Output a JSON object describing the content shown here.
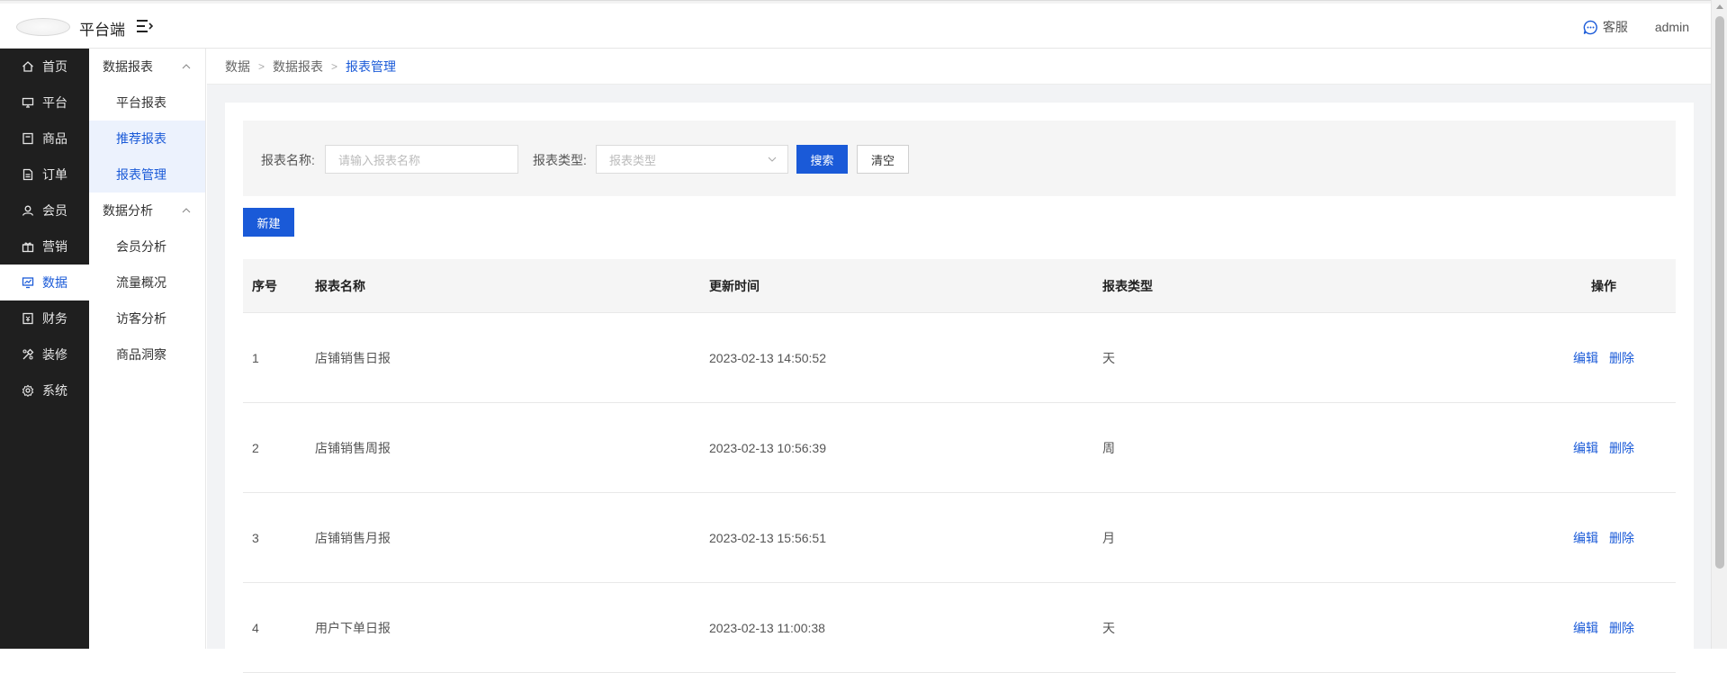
{
  "header": {
    "brand": "平台端",
    "kefu_label": "客服",
    "user": "admin"
  },
  "sidebar": {
    "items": [
      {
        "label": "首页",
        "icon": "home-icon",
        "active": false
      },
      {
        "label": "平台",
        "icon": "monitor-icon",
        "active": false
      },
      {
        "label": "商品",
        "icon": "goods-icon",
        "active": false
      },
      {
        "label": "订单",
        "icon": "order-icon",
        "active": false
      },
      {
        "label": "会员",
        "icon": "member-icon",
        "active": false
      },
      {
        "label": "营销",
        "icon": "gift-icon",
        "active": false
      },
      {
        "label": "数据",
        "icon": "chart-icon",
        "active": true
      },
      {
        "label": "财务",
        "icon": "finance-icon",
        "active": false
      },
      {
        "label": "装修",
        "icon": "decorate-icon",
        "active": false
      },
      {
        "label": "系统",
        "icon": "settings-icon",
        "active": false
      }
    ]
  },
  "subnav": {
    "group1": "数据报表",
    "group1_items": [
      "平台报表",
      "推荐报表",
      "报表管理"
    ],
    "group2": "数据分析",
    "group2_items": [
      "会员分析",
      "流量概况",
      "访客分析",
      "商品洞察"
    ]
  },
  "breadcrumb": [
    "数据",
    "数据报表",
    "报表管理"
  ],
  "filter": {
    "name_label": "报表名称:",
    "name_placeholder": "请输入报表名称",
    "type_label": "报表类型:",
    "type_placeholder": "报表类型",
    "search_btn": "搜索",
    "clear_btn": "清空"
  },
  "new_btn": "新建",
  "table": {
    "headers": [
      "序号",
      "报表名称",
      "更新时间",
      "报表类型",
      "操作"
    ],
    "rows": [
      {
        "idx": "1",
        "name": "店铺销售日报",
        "time": "2023-02-13 14:50:52",
        "type": "天"
      },
      {
        "idx": "2",
        "name": "店铺销售周报",
        "time": "2023-02-13 10:56:39",
        "type": "周"
      },
      {
        "idx": "3",
        "name": "店铺销售月报",
        "time": "2023-02-13 15:56:51",
        "type": "月"
      },
      {
        "idx": "4",
        "name": "用户下单日报",
        "time": "2023-02-13 11:00:38",
        "type": "天"
      }
    ],
    "edit_label": "编辑",
    "delete_label": "删除"
  },
  "colors": {
    "accent": "#1a5ad8",
    "sidebar_bg": "#1f1f1f"
  }
}
